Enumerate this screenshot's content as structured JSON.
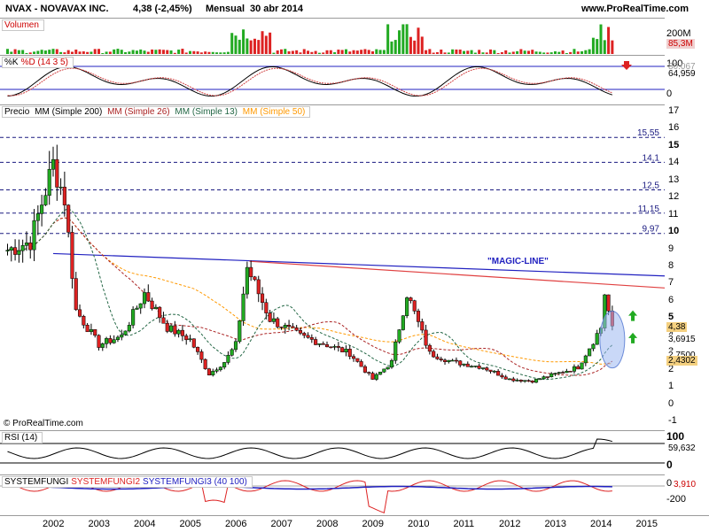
{
  "header": {
    "symbol": "NVAX - NOVAVAX INC.",
    "price_change": "4,38 (-2,45%)",
    "period": "Mensual",
    "date": "30 abr 2014",
    "site": "www.ProRealTime.com"
  },
  "colors": {
    "up": "#22aa22",
    "down": "#dd2222",
    "mm200": "#000000",
    "mm26": "#aa2222",
    "mm13": "#226644",
    "mm50": "#ff9900",
    "magic_blue": "#2020c0",
    "magic_red": "#e04040"
  },
  "volume_panel": {
    "label": "Volumen",
    "ticks": [
      "200M"
    ],
    "last_value": "85,3M"
  },
  "stoch_panel": {
    "label_k": "%K",
    "label_d": "%D (14 3 5)",
    "ticks": [
      "100",
      "0"
    ],
    "values": [
      "80,067",
      "64,959"
    ]
  },
  "price_panel": {
    "labels": [
      "Precio",
      "MM (Simple 200)",
      "MM (Simple 26)",
      "MM (Simple 13)",
      "MM (Simple 50)"
    ],
    "ticks": [
      "17",
      "16",
      "15",
      "14",
      "13",
      "12",
      "11",
      "10",
      "9",
      "8",
      "7",
      "6",
      "5",
      "4",
      "3",
      "2",
      "1",
      "0",
      "-1"
    ],
    "levels": [
      {
        "label": "15,55",
        "value": 15.55
      },
      {
        "label": "14,1",
        "value": 14.1
      },
      {
        "label": "12,5",
        "value": 12.5
      },
      {
        "label": "11,15",
        "value": 11.15
      },
      {
        "label": "9,97",
        "value": 9.97
      }
    ],
    "magic_line_label": "\"MAGIC-LINE\"",
    "value_tags": [
      "4,38",
      "3,6915",
      "2,7500",
      "2,4302"
    ],
    "copyright": "© ProRealTime.com"
  },
  "rsi_panel": {
    "label": "RSI (14)",
    "ticks": [
      "100",
      "0"
    ],
    "value": "59,632"
  },
  "sf_panel": {
    "labels": [
      "SYSTEMFUNGI",
      "SYSTEMFUNGI2",
      "SYSTEMFUNGI3 (40 100)"
    ],
    "ticks": [
      "0",
      "-200"
    ],
    "value": "3,910"
  },
  "x_axis": {
    "years": [
      "2002",
      "2003",
      "2004",
      "2005",
      "2006",
      "2007",
      "2008",
      "2009",
      "2010",
      "2011",
      "2012",
      "2013",
      "2014",
      "2015"
    ]
  },
  "chart_data": {
    "type": "candlestick",
    "title": "NVAX - NOVAVAX INC. Mensual",
    "period": "monthly",
    "x_range": [
      "2001",
      "2015"
    ],
    "ylim": [
      -1,
      17
    ],
    "last_close": 4.38,
    "change_pct": -2.45,
    "levels": [
      15.55,
      14.1,
      12.5,
      11.15,
      9.97
    ],
    "magic_line": {
      "start": {
        "date": "2002-01",
        "value": 8.8
      },
      "end": {
        "date": "2015-01",
        "value": 7.5
      }
    },
    "series": [
      {
        "name": "Precio",
        "dates": [
          "2001-01",
          "2001-07",
          "2002-01",
          "2002-04",
          "2002-07",
          "2003-01",
          "2003-07",
          "2004-01",
          "2004-07",
          "2005-01",
          "2005-06",
          "2005-10",
          "2006-01",
          "2006-04",
          "2006-10",
          "2007-06",
          "2008-01",
          "2008-07",
          "2009-01",
          "2009-06",
          "2009-10",
          "2010-04",
          "2010-10",
          "2011-06",
          "2012-01",
          "2012-07",
          "2013-01",
          "2013-07",
          "2014-01",
          "2014-02",
          "2014-04"
        ],
        "values": [
          9.0,
          9.5,
          14.0,
          12.0,
          5.5,
          3.5,
          4.0,
          6.5,
          4.5,
          3.8,
          1.8,
          2.5,
          3.5,
          8.0,
          5.0,
          4.0,
          3.5,
          3.0,
          1.5,
          2.5,
          6.5,
          3.0,
          2.5,
          2.2,
          1.5,
          1.4,
          1.8,
          2.2,
          4.5,
          6.5,
          4.38
        ]
      },
      {
        "name": "MM (Simple 200)",
        "values": [
          3.6915
        ]
      },
      {
        "name": "MM (Simple 26)",
        "values": [
          3.6915
        ]
      },
      {
        "name": "MM (Simple 13)",
        "values": [
          2.75
        ]
      },
      {
        "name": "MM (Simple 50)",
        "values": [
          2.4302
        ]
      }
    ]
  }
}
